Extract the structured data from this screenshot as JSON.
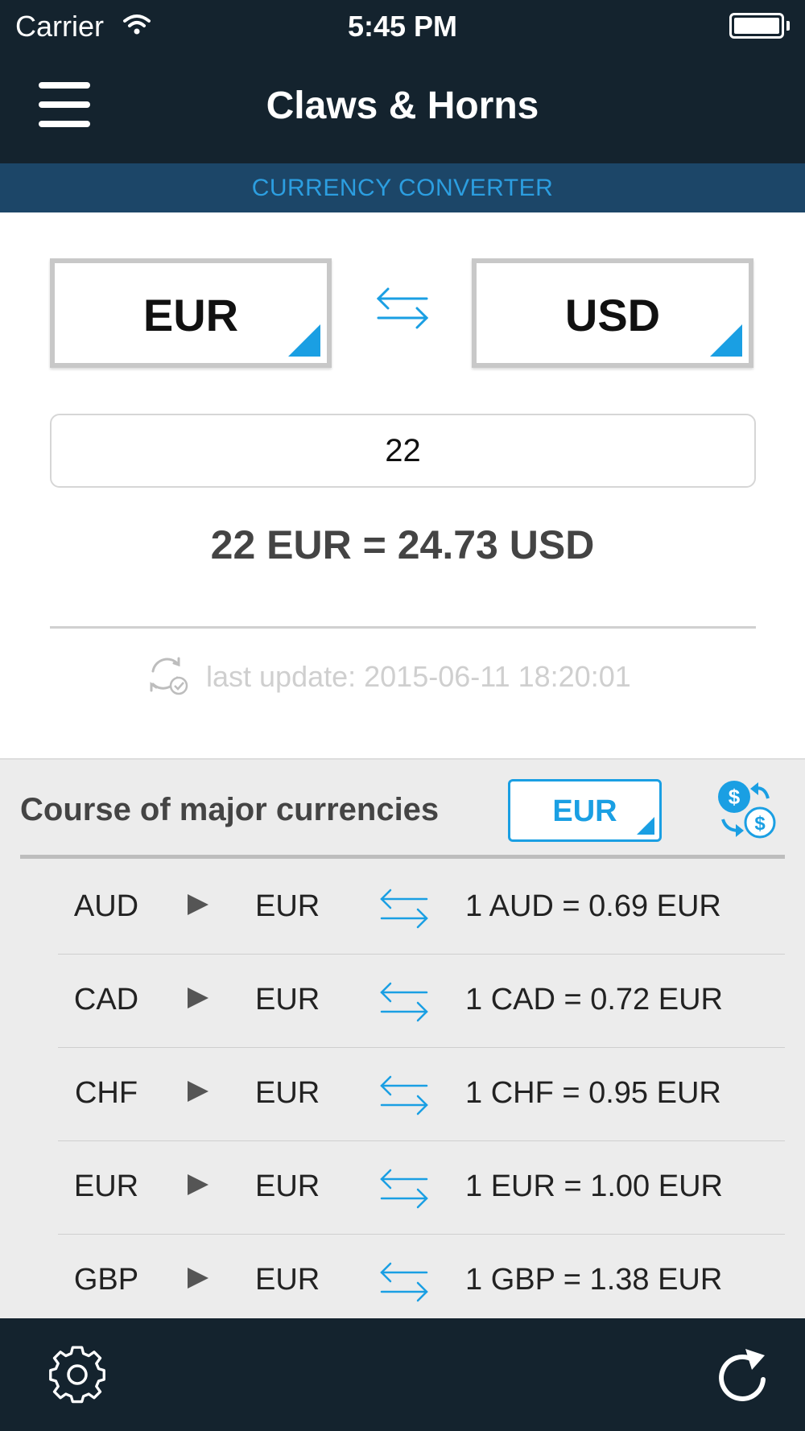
{
  "status_bar": {
    "carrier": "Carrier",
    "time": "5:45 PM"
  },
  "header": {
    "title": "Claws & Horns",
    "menu_icon": "hamburger-menu-icon"
  },
  "section": {
    "title": "CURRENCY CONVERTER"
  },
  "converter": {
    "from_currency": "EUR",
    "to_currency": "USD",
    "amount": "22",
    "result": "22 EUR = 24.73 USD",
    "last_update": "last update: 2015-06-11 18:20:01"
  },
  "rates": {
    "title": "Course of major currencies",
    "base_currency": "EUR",
    "rows": [
      {
        "from": "AUD",
        "to": "EUR",
        "rate": "1 AUD = 0.69 EUR"
      },
      {
        "from": "CAD",
        "to": "EUR",
        "rate": "1 CAD = 0.72 EUR"
      },
      {
        "from": "CHF",
        "to": "EUR",
        "rate": "1 CHF = 0.95 EUR"
      },
      {
        "from": "EUR",
        "to": "EUR",
        "rate": "1 EUR = 1.00 EUR"
      },
      {
        "from": "GBP",
        "to": "EUR",
        "rate": "1 GBP = 1.38 EUR"
      }
    ]
  },
  "footer": {
    "settings_icon": "gear-icon",
    "refresh_icon": "refresh-icon"
  },
  "colors": {
    "header_bg": "#14232e",
    "section_bg": "#1c4668",
    "accent": "#1a9fe3",
    "rates_bg": "#ececec"
  }
}
